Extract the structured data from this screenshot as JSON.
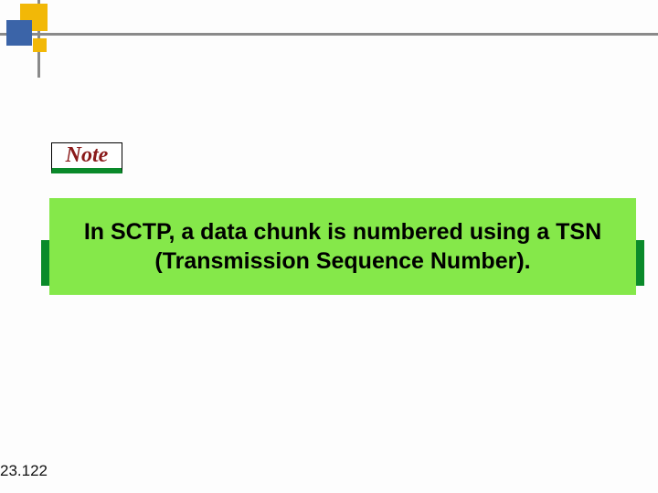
{
  "note": {
    "label": "Note"
  },
  "body": {
    "text": "In SCTP, a data chunk is numbered using a TSN (Transmission Sequence Number)."
  },
  "page": {
    "number": "23.122"
  },
  "colors": {
    "green_light": "#85e84a",
    "green_dark": "#0a8a2a",
    "orange": "#f2b807",
    "blue": "#3b64a8",
    "note_text": "#8a1a1a"
  }
}
